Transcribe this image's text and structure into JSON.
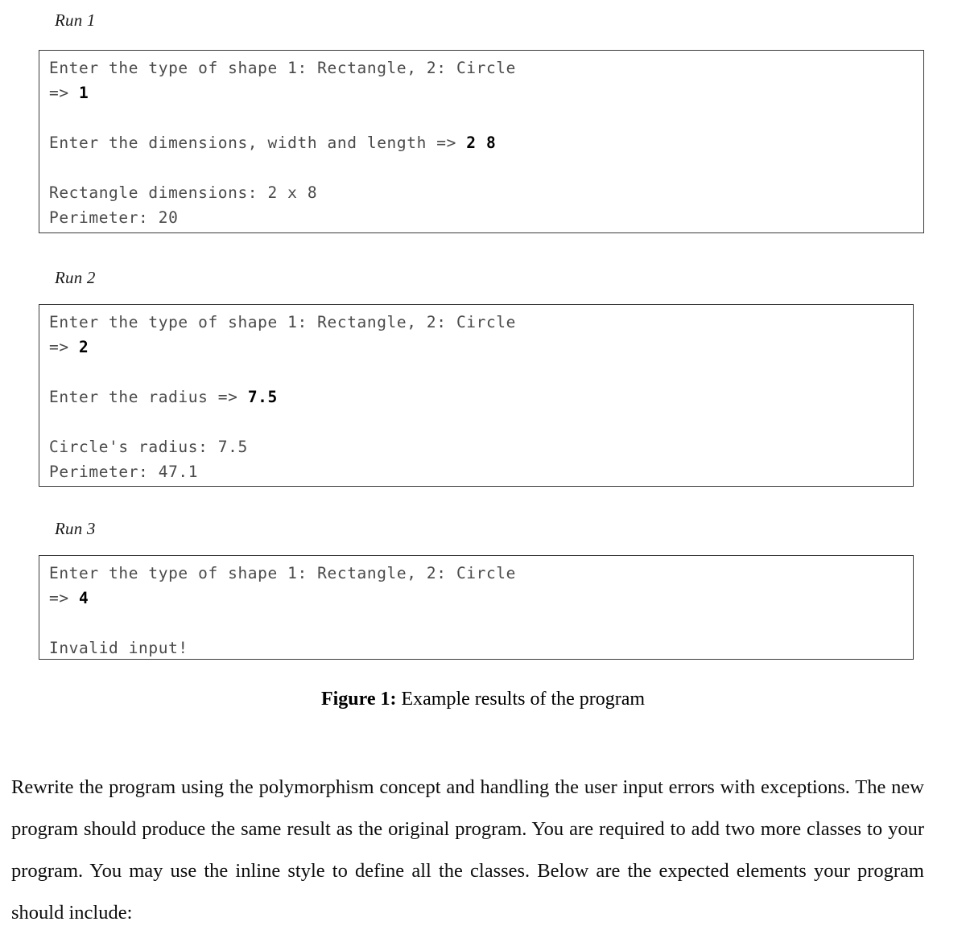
{
  "document": {
    "runs": [
      {
        "label": "Run 1",
        "lines": [
          {
            "type": "text",
            "prompt": "Enter the type of shape 1: Rectangle, 2: Circle"
          },
          {
            "type": "text",
            "prompt": "=> ",
            "input": "1"
          },
          {
            "type": "blank"
          },
          {
            "type": "text",
            "prompt": "Enter the dimensions, width and length => ",
            "input": "2 8"
          },
          {
            "type": "blank"
          },
          {
            "type": "text",
            "prompt": "Rectangle dimensions: 2 x 8"
          },
          {
            "type": "text",
            "prompt": "Perimeter: 20"
          }
        ]
      },
      {
        "label": "Run 2",
        "lines": [
          {
            "type": "text",
            "prompt": "Enter the type of shape 1: Rectangle, 2: Circle"
          },
          {
            "type": "text",
            "prompt": "=> ",
            "input": "2"
          },
          {
            "type": "blank"
          },
          {
            "type": "text",
            "prompt": "Enter the radius => ",
            "input": "7.5"
          },
          {
            "type": "blank"
          },
          {
            "type": "text",
            "prompt": "Circle's radius: 7.5"
          },
          {
            "type": "text",
            "prompt": "Perimeter: 47.1"
          }
        ]
      },
      {
        "label": "Run 3",
        "lines": [
          {
            "type": "text",
            "prompt": "Enter the type of shape 1: Rectangle, 2: Circle"
          },
          {
            "type": "text",
            "prompt": "=> ",
            "input": "4"
          },
          {
            "type": "blank"
          },
          {
            "type": "text",
            "prompt": "Invalid input!"
          }
        ]
      }
    ],
    "figure_caption": {
      "number": "Figure 1:",
      "text": " Example results of the program"
    },
    "paragraph": "Rewrite the program using the polymorphism concept and handling the user input errors with exceptions. The new program should produce the same result as the original program. You are required to add two more classes to your program. You may use the inline style to define all the classes. Below are the expected elements your program should include:"
  }
}
